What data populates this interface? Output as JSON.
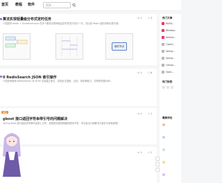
{
  "nav": {
    "item1": "首页",
    "item2": "教程",
    "item3": "软件",
    "search_placeholder": "搜索..."
  },
  "posts": [
    {
      "title": "算法实现轻量级分布式定时任务",
      "summary": "介绍如何 Redis + SchedulerLock 在多个服务实例间保证定时任务只执行一次，并比较 Redis 锁的多种实现方案...",
      "diagram_label": "临时节点",
      "comments": "1",
      "likes": "4"
    },
    {
      "title": "0 RedisSearch JSON 索引操作",
      "summary": "介绍如何使用 RedisSearch 对 JSON 文档建立索引，实现全文搜索、过滤、排序等能力，并附带完整示例...",
      "comments": "1",
      "likes": "6"
    },
    {
      "badge": "精选",
      "title": "gboot 接口返回字符串带引号的问题解决",
      "summary": "Spring Boot 接口返回字符串时会带上引号，原因是消息转换器的顺序不同，本文给出几种解决方案并分析其原理...",
      "comments": "1",
      "likes": "1"
    },
    {
      "comments": "1",
      "likes": "2"
    }
  ],
  "sidebar": {
    "heading1": "热门文章",
    "hot": [
      {
        "rank": "1",
        "label": "MySQ..."
      },
      {
        "rank": "2",
        "label": "Window..."
      },
      {
        "rank": "3",
        "label": "Jenkins..."
      },
      {
        "rank": "4",
        "label": "Cyphe..."
      },
      {
        "rank": "5",
        "label": "Spring..."
      },
      {
        "rank": "6",
        "label": "Spring..."
      },
      {
        "rank": "7",
        "label": "Centos..."
      },
      {
        "rank": "8",
        "label": "Open..."
      }
    ],
    "heading2": "热门标签",
    "heading3": "最新评论"
  },
  "colors": {
    "accent": "#e14a3b",
    "tag_purple": "#9b6cd1"
  }
}
